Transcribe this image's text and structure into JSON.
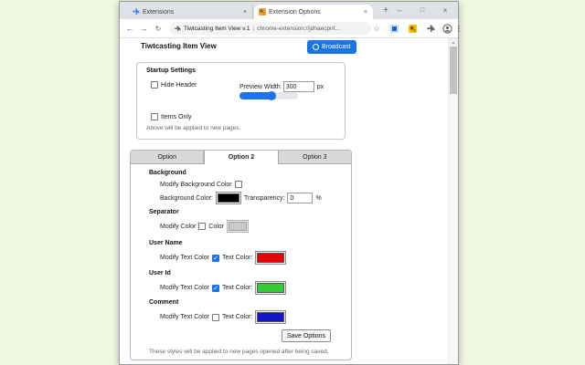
{
  "glyphs": {
    "back": "←",
    "forward": "→",
    "reload": "↻",
    "star": "☆",
    "menu_dots": "⋮",
    "new_tab": "+",
    "tab_close": "×",
    "minimize": "–",
    "maximize": "□",
    "close": "×",
    "scroll_up": "▲"
  },
  "browser": {
    "tabs": [
      {
        "label": "Extensions"
      },
      {
        "label": "Extension Options"
      }
    ],
    "address": {
      "page_label": "Tiwtcasting Item View v.1",
      "divider": "|",
      "url": "chrome-extension://jdhaecpnf..."
    }
  },
  "page": {
    "title": "Tiwtcasting Item View",
    "broadcast_label": "Broadcast",
    "startup": {
      "heading": "Startup Settings",
      "hide_header_label": "Hide Header",
      "hide_header_checked": false,
      "preview_width_label": "Preview Width",
      "preview_width_value": "300",
      "preview_width_unit": "px",
      "slider_percent": 55,
      "items_only_label": "Items Only",
      "items_only_checked": false,
      "note": "Above will be applied to new pages."
    },
    "options": {
      "tabs": [
        "Option",
        "Option 2",
        "Option 3"
      ],
      "active_tab": "Option 2",
      "background": {
        "heading": "Background",
        "modify_label": "Modify Background Color",
        "modify_checked": false,
        "color_label": "Background Color:",
        "color_value": "#000000",
        "transparency_label": "Transparency:",
        "transparency_value": "0",
        "transparency_unit": "%"
      },
      "separator": {
        "heading": "Separator",
        "modify_label": "Modify Color",
        "modify_checked": false,
        "color_label": "Color",
        "color_value": "#c9c9c9"
      },
      "user_name": {
        "heading": "User Name",
        "modify_label": "Modify Text Color",
        "modify_checked": true,
        "color_label": "Text Color:",
        "color_value": "#e60000"
      },
      "user_id": {
        "heading": "User Id",
        "modify_label": "Modify Text Color",
        "modify_checked": true,
        "color_label": "Text Color:",
        "color_value": "#33cc33"
      },
      "comment": {
        "heading": "Comment",
        "modify_label": "Modify Text Color",
        "modify_checked": false,
        "color_label": "Text Color:",
        "color_value": "#1414cc"
      },
      "save_label": "Save Options",
      "note": "These styles will be applied to new pages opened after being saved."
    }
  },
  "colors": {
    "accent_blue": "#1a73e8",
    "desktop_bg": "#f1f8e2",
    "tabstrip_bg": "#dee1e6"
  }
}
